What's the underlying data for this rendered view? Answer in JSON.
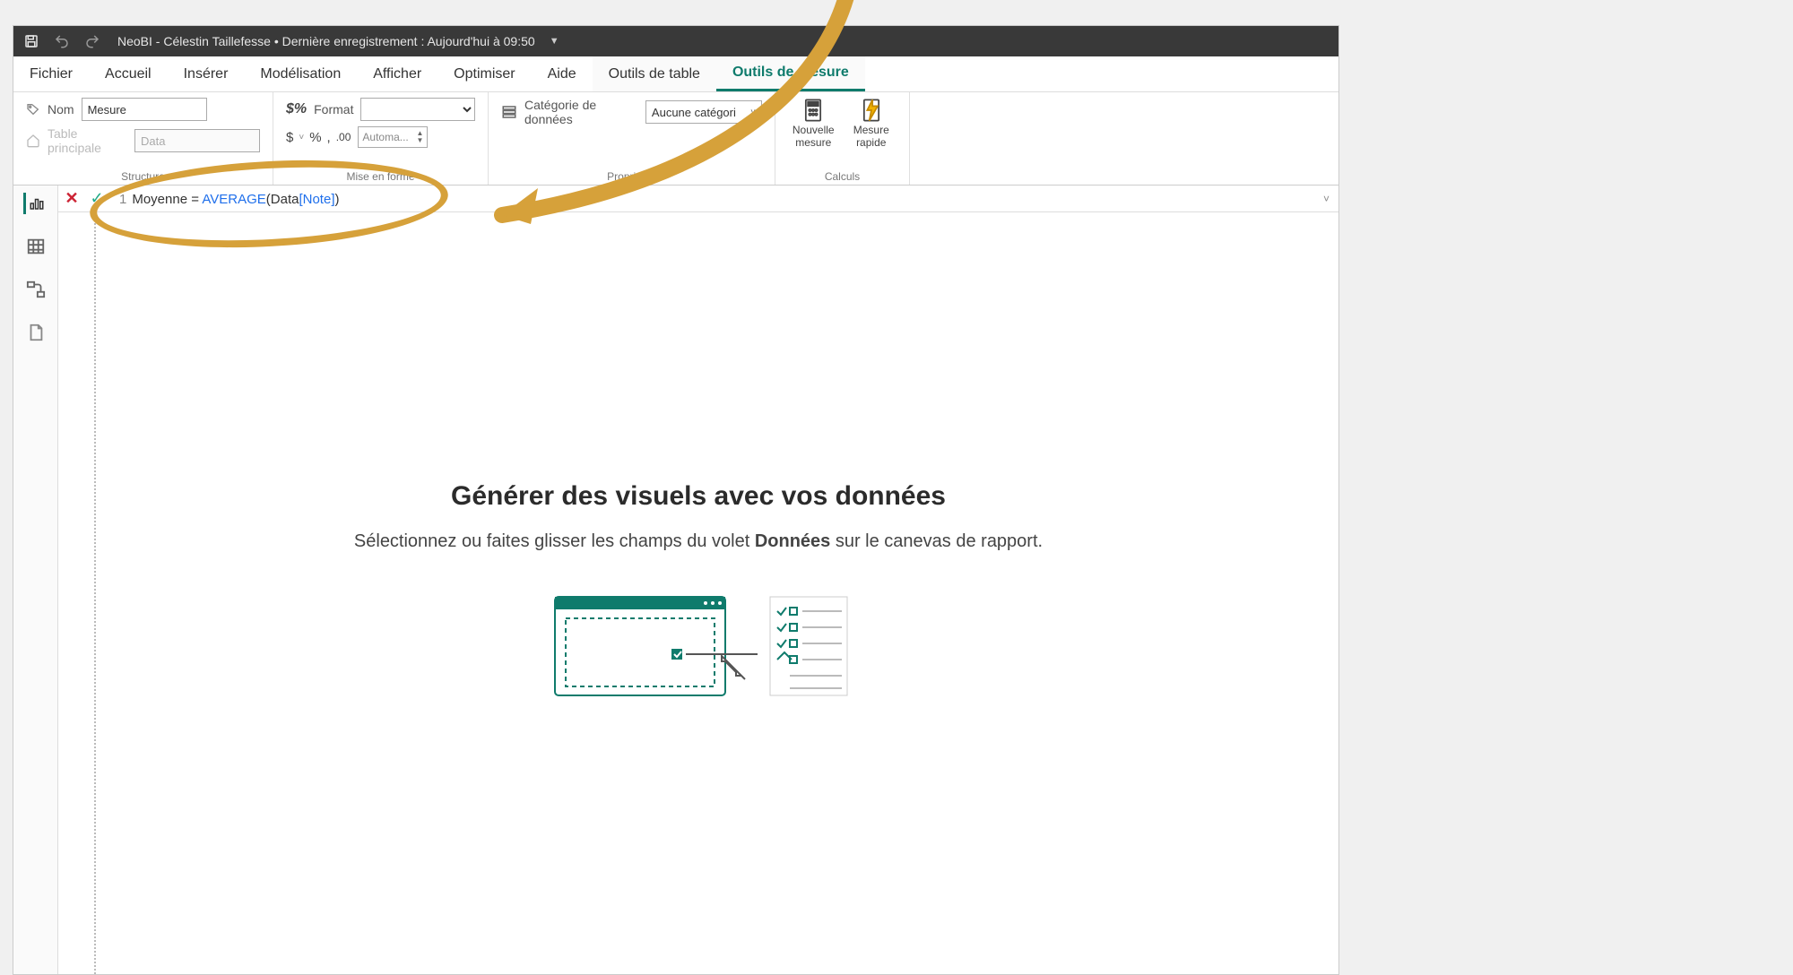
{
  "titlebar": {
    "title": "NeoBI - Célestin Taillefesse  •  Dernière enregistrement : Aujourd'hui à 09:50"
  },
  "tabs": {
    "fichier": "Fichier",
    "accueil": "Accueil",
    "inserer": "Insérer",
    "modelisation": "Modélisation",
    "afficher": "Afficher",
    "optimiser": "Optimiser",
    "aide": "Aide",
    "outils_table": "Outils de table",
    "outils_mesure": "Outils de mesure"
  },
  "ribbon": {
    "structure": {
      "nom_label": "Nom",
      "nom_value": "Mesure",
      "table_label": "Table principale",
      "table_value": "Data",
      "group_label": "Structure"
    },
    "format": {
      "format_label": "Format",
      "format_value": "",
      "currency": "$",
      "percent": "%",
      "comma": ",",
      "dec": ".00",
      "auto_label": "Automa...",
      "group_label": "Mise en forme"
    },
    "props": {
      "cat_label": "Catégorie de données",
      "cat_value": "Aucune catégori",
      "group_label": "Propriétés"
    },
    "calc": {
      "new_measure": "Nouvelle mesure",
      "quick_measure": "Mesure rapide",
      "group_label": "Calculs"
    }
  },
  "formula": {
    "line_no": "1",
    "measure_name": "Moyenne",
    "equals": " = ",
    "func": "AVERAGE",
    "open": "(",
    "table_ref": "Data",
    "col_open": "[",
    "col_name": "Note",
    "col_close": "]",
    "close": ")"
  },
  "canvas": {
    "title": "Générer des visuels avec vos données",
    "sub_pre": "Sélectionnez ou faites glisser les champs du volet ",
    "sub_bold": "Données",
    "sub_post": " sur le canevas de rapport."
  }
}
